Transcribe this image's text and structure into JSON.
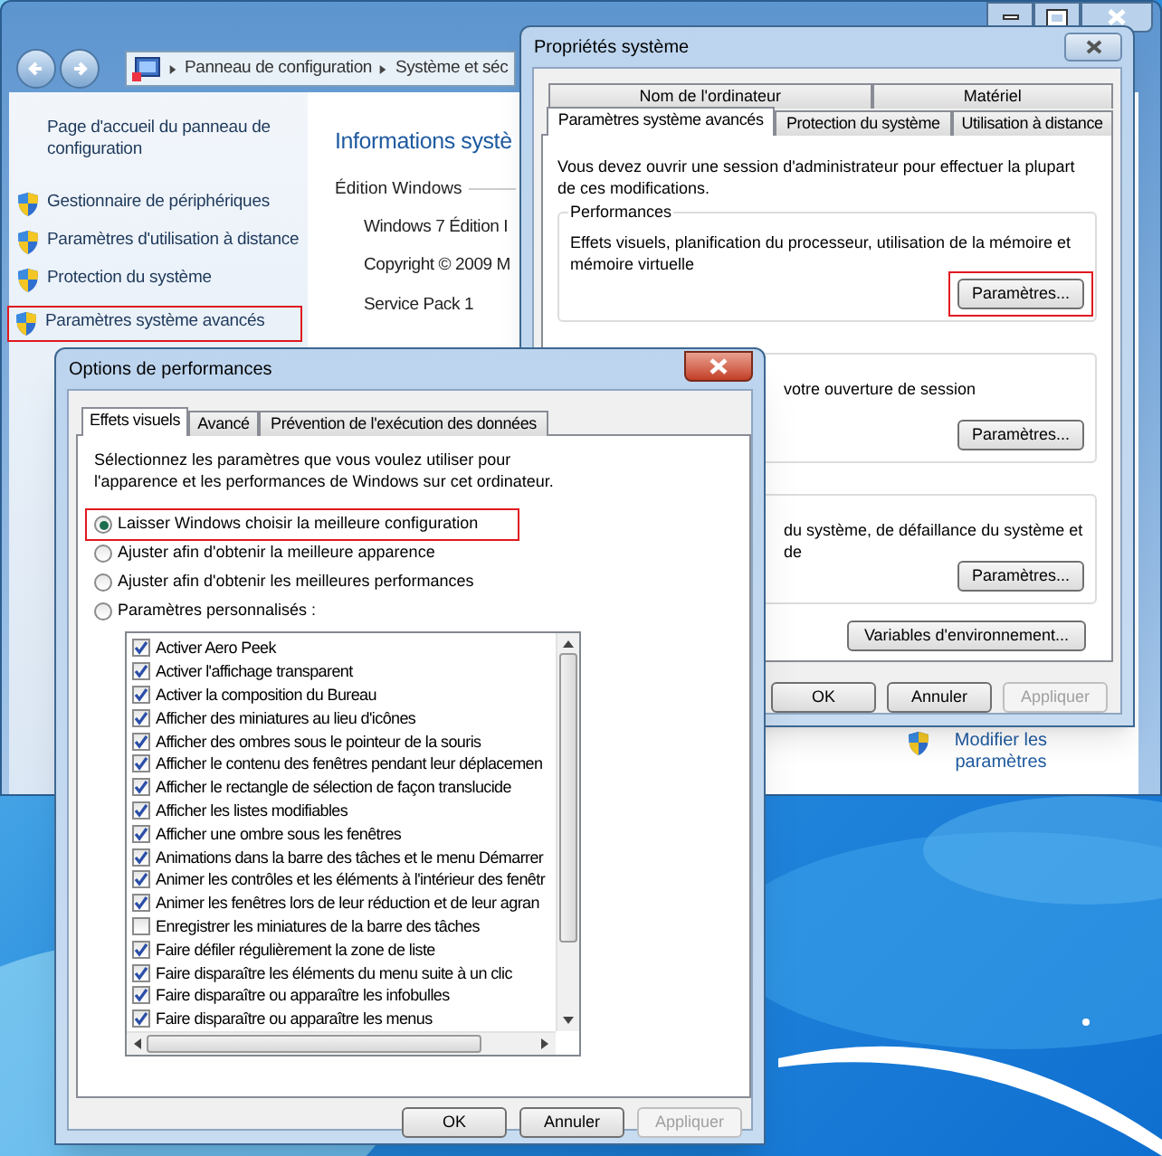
{
  "control_panel": {
    "breadcrumb": [
      "Panneau de configuration",
      "Système et séc"
    ],
    "sidebar_items": [
      {
        "label": "Page d'accueil du panneau de configuration",
        "kind": "home",
        "highlighted": false
      },
      {
        "label": "Gestionnaire de périphériques",
        "kind": "shield",
        "highlighted": false
      },
      {
        "label": "Paramètres d'utilisation à distance",
        "kind": "shield",
        "highlighted": false
      },
      {
        "label": "Protection du système",
        "kind": "shield",
        "highlighted": false
      },
      {
        "label": "Paramètres système avancés",
        "kind": "shield",
        "highlighted": true
      }
    ],
    "heading": "Informations systè",
    "section": "Édition Windows",
    "details": [
      "Windows 7 Édition I",
      "Copyright © 2009 M",
      "Service Pack 1"
    ],
    "change_link": "Modifier les paramètres"
  },
  "system_properties": {
    "title": "Propriétés système",
    "back_tabs": [
      {
        "label": "Nom de l'ordinateur"
      },
      {
        "label": "Matériel"
      }
    ],
    "tabs": [
      {
        "label": "Paramètres système avancés",
        "selected": true
      },
      {
        "label": "Protection du système",
        "selected": false
      },
      {
        "label": "Utilisation à distance",
        "selected": false
      }
    ],
    "notice": "Vous devez ouvrir une session d'administrateur pour effectuer la plupart de ces modifications.",
    "groups": [
      {
        "kind": "full",
        "label": "Performances",
        "description": "Effets visuels, planification du processeur, utilisation de la mémoire et mémoire virtuelle",
        "button": "Paramètres...",
        "highlighted": true
      },
      {
        "kind": "covered",
        "description": "votre ouverture de session",
        "button": "Paramètres...",
        "highlighted": false
      },
      {
        "kind": "covered",
        "description": "du système, de défaillance du système et de",
        "button": "Paramètres...",
        "highlighted": false
      }
    ],
    "env_button": "Variables d'environnement...",
    "buttons": [
      {
        "label": "OK",
        "disabled": false
      },
      {
        "label": "Annuler",
        "disabled": false
      },
      {
        "label": "Appliquer",
        "disabled": true
      }
    ]
  },
  "performance_options": {
    "title": "Options de performances",
    "tabs": [
      {
        "label": "Effets visuels",
        "selected": true
      },
      {
        "label": "Avancé",
        "selected": false
      },
      {
        "label": "Prévention de l'exécution des données",
        "selected": false
      }
    ],
    "intro": "Sélectionnez les paramètres que vous voulez utiliser pour l'apparence et les performances de Windows sur cet ordinateur.",
    "options": [
      {
        "label": "Laisser Windows choisir la meilleure configuration",
        "selected": true,
        "highlighted": true
      },
      {
        "label": "Ajuster afin d'obtenir la meilleure apparence",
        "selected": false,
        "highlighted": false
      },
      {
        "label": "Ajuster afin d'obtenir les meilleures performances",
        "selected": false,
        "highlighted": false
      },
      {
        "label": "Paramètres personnalisés :",
        "selected": false,
        "highlighted": false
      }
    ],
    "effects": [
      {
        "label": "Activer Aero Peek",
        "checked": true
      },
      {
        "label": "Activer l'affichage transparent",
        "checked": true
      },
      {
        "label": "Activer la composition du Bureau",
        "checked": true
      },
      {
        "label": "Afficher des miniatures au lieu d'icônes",
        "checked": true
      },
      {
        "label": "Afficher des ombres sous le pointeur de la souris",
        "checked": true
      },
      {
        "label": "Afficher le contenu des fenêtres pendant leur déplacemen",
        "checked": true
      },
      {
        "label": "Afficher le rectangle de sélection de façon translucide",
        "checked": true
      },
      {
        "label": "Afficher les listes modifiables",
        "checked": true
      },
      {
        "label": "Afficher une ombre sous les fenêtres",
        "checked": true
      },
      {
        "label": "Animations dans la barre des tâches et le menu Démarrer",
        "checked": true
      },
      {
        "label": "Animer les contrôles et les éléments à l'intérieur des fenêtr",
        "checked": true
      },
      {
        "label": "Animer les fenêtres lors de leur réduction et de leur agran",
        "checked": true
      },
      {
        "label": "Enregistrer les miniatures de la barre des tâches",
        "checked": false
      },
      {
        "label": "Faire défiler régulièrement la zone de liste",
        "checked": true
      },
      {
        "label": "Faire disparaître les éléments du menu suite à un clic",
        "checked": true
      },
      {
        "label": "Faire disparaître ou apparaître les infobulles",
        "checked": true
      },
      {
        "label": "Faire disparaître ou apparaître les menus",
        "checked": true
      }
    ],
    "buttons": [
      {
        "label": "OK",
        "disabled": false
      },
      {
        "label": "Annuler",
        "disabled": false
      },
      {
        "label": "Appliquer",
        "disabled": true
      }
    ]
  }
}
